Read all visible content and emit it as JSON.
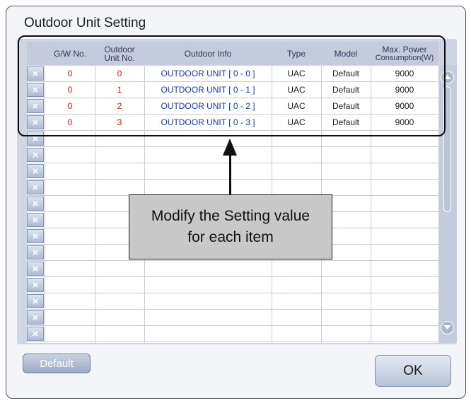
{
  "window": {
    "title": "Outdoor Unit Setting"
  },
  "table": {
    "columns": {
      "gw_no": "G/W No.",
      "outdoor_unit_no_line1": "Outdoor",
      "outdoor_unit_no_line2": "Unit No.",
      "outdoor_info": "Outdoor Info",
      "type": "Type",
      "model": "Model",
      "max_power_line1": "Max. Power",
      "max_power_line2": "Consumption(W)"
    },
    "delete_icon": "×",
    "rows": [
      {
        "gw_no": "0",
        "unit_no": "0",
        "info": "OUTDOOR UNIT [ 0 - 0 ]",
        "type": "UAC",
        "model": "Default",
        "max_power": "9000"
      },
      {
        "gw_no": "0",
        "unit_no": "1",
        "info": "OUTDOOR UNIT [ 0 - 1 ]",
        "type": "UAC",
        "model": "Default",
        "max_power": "9000"
      },
      {
        "gw_no": "0",
        "unit_no": "2",
        "info": "OUTDOOR UNIT [ 0 - 2 ]",
        "type": "UAC",
        "model": "Default",
        "max_power": "9000"
      },
      {
        "gw_no": "0",
        "unit_no": "3",
        "info": "OUTDOOR UNIT [ 0 - 3 ]",
        "type": "UAC",
        "model": "Default",
        "max_power": "9000"
      }
    ],
    "empty_row_count": 13
  },
  "annotation": {
    "line1": "Modify the Setting value",
    "line2": "for each item"
  },
  "buttons": {
    "default_label": "Default",
    "ok_label": "OK"
  },
  "icons": {
    "scroll_up": "chevron-up-icon",
    "scroll_down": "chevron-down-icon",
    "delete": "close-icon"
  },
  "colors": {
    "id_red": "#e8101a",
    "info_blue": "#1535c8",
    "panel": "#cfd5e2"
  }
}
